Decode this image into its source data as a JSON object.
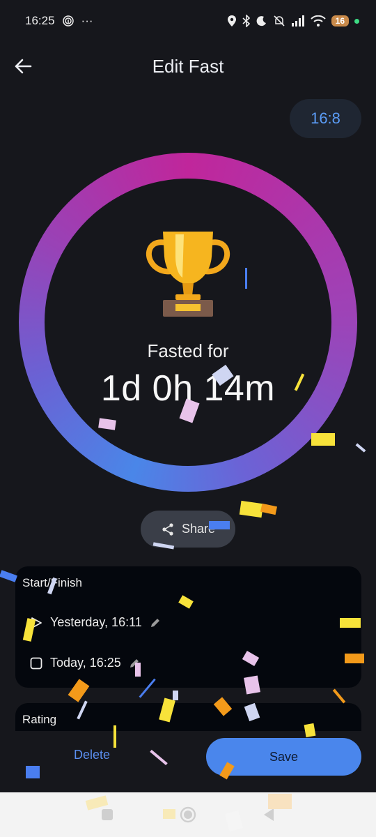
{
  "status_bar": {
    "time": "16:25",
    "more": "···",
    "battery": "16",
    "icons": [
      "fingerprint-icon",
      "location-icon",
      "bluetooth-icon",
      "moon-icon",
      "mute-icon",
      "signal-icon",
      "wifi-icon"
    ]
  },
  "header": {
    "title": "Edit Fast",
    "back_icon": "arrow-left-icon"
  },
  "plan_chip": {
    "label": "16:8"
  },
  "progress": {
    "icon": "trophy-icon",
    "label": "Fasted for",
    "duration": "1d 0h 14m",
    "colors": {
      "start": "#c0269b",
      "mid": "#6b63d6",
      "end": "#4a86e8"
    }
  },
  "share": {
    "label": "Share",
    "icon": "share-icon"
  },
  "start_finish": {
    "title": "Start/Finish",
    "start": {
      "label": "Yesterday, 16:11",
      "icon": "play-icon"
    },
    "finish": {
      "label": "Today, 16:25",
      "icon": "stop-icon"
    },
    "edit_icon": "pencil-icon"
  },
  "rating": {
    "title": "Rating"
  },
  "actions": {
    "delete_label": "Delete",
    "save_label": "Save",
    "accent": "#4a86ec"
  },
  "nav": {
    "icons": [
      "recents-icon",
      "home-icon",
      "back-icon"
    ]
  }
}
